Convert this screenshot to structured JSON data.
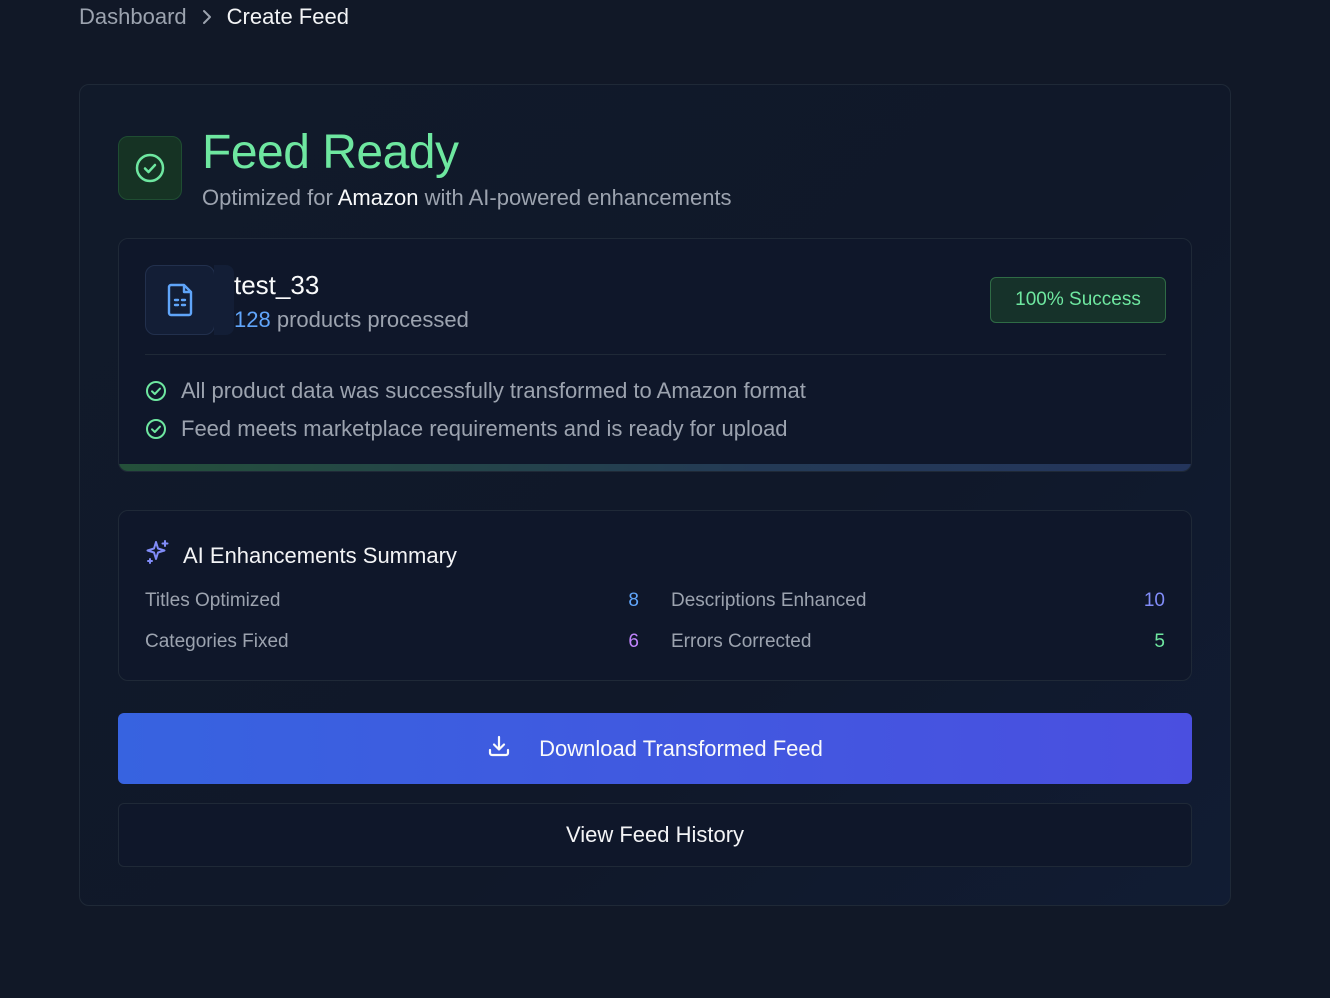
{
  "breadcrumb": {
    "root": "Dashboard",
    "current": "Create Feed"
  },
  "hero": {
    "title": "Feed Ready",
    "subtitle_prefix": "Optimized for",
    "marketplace": "Amazon",
    "subtitle_suffix": "with AI-powered enhancements",
    "icon": "check-circle-icon"
  },
  "file": {
    "name": "test_33",
    "product_count": "128",
    "count_suffix": "products processed",
    "badge": "100% Success",
    "icon": "file-spreadsheet-icon",
    "checks": [
      "All product data was successfully transformed to Amazon format",
      "Feed meets marketplace requirements and is ready for upload"
    ]
  },
  "ai_summary": {
    "title": "AI Enhancements Summary",
    "icon": "sparkles-icon",
    "stats": [
      {
        "label": "Titles Optimized",
        "value": "8",
        "color": "#60a5fa"
      },
      {
        "label": "Descriptions Enhanced",
        "value": "10",
        "color": "#818cf8"
      },
      {
        "label": "Categories Fixed",
        "value": "6",
        "color": "#c084fc"
      },
      {
        "label": "Errors Corrected",
        "value": "5",
        "color": "#6ee7a0"
      }
    ]
  },
  "actions": {
    "download_label": "Download Transformed Feed",
    "history_label": "View Feed History"
  },
  "colors": {
    "background": "#111827",
    "success": "#6ee7a0",
    "accent": "#3763e0"
  }
}
